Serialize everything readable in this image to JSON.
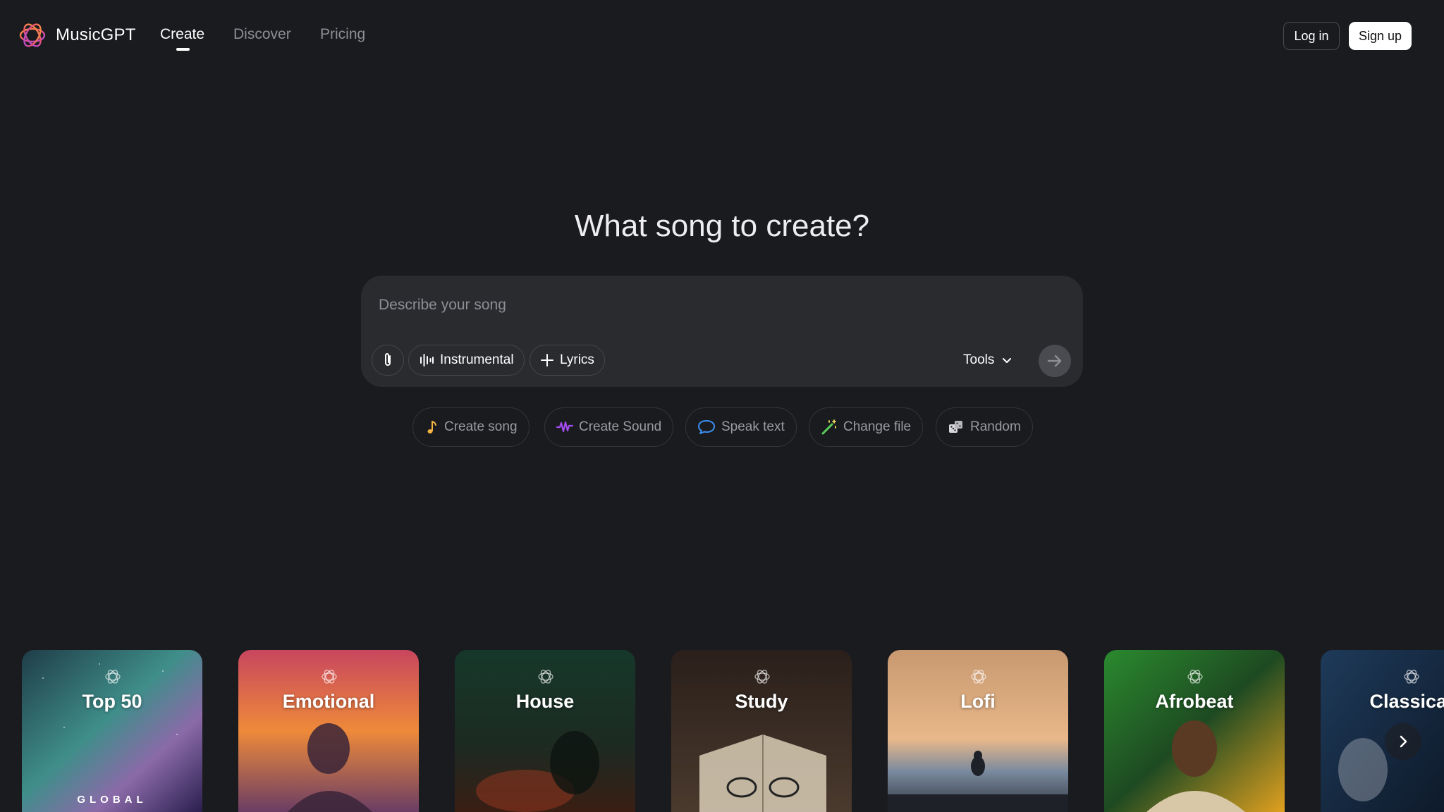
{
  "header": {
    "brand": "MusicGPT",
    "nav": [
      {
        "label": "Create",
        "active": true
      },
      {
        "label": "Discover",
        "active": false
      },
      {
        "label": "Pricing",
        "active": false
      }
    ],
    "login_label": "Log in",
    "signup_label": "Sign up"
  },
  "hero": {
    "title": "What song to create?"
  },
  "prompt": {
    "placeholder": "Describe your song",
    "value": "",
    "attach_icon": "paperclip-icon",
    "instrumental_label": "Instrumental",
    "lyrics_label": "Lyrics",
    "tools_label": "Tools",
    "send_icon": "arrow-right-icon"
  },
  "suggestions": [
    {
      "label": "Create song",
      "icon": "music-note-icon",
      "color": "#f5b342"
    },
    {
      "label": "Create Sound",
      "icon": "waveform-icon",
      "color": "#a24cf0"
    },
    {
      "label": "Speak text",
      "icon": "speech-bubble-icon",
      "color": "#3b8ff0"
    },
    {
      "label": "Change file",
      "icon": "magic-wand-icon",
      "color": "#5ad05a"
    },
    {
      "label": "Random",
      "icon": "dice-icon",
      "color": "#d0d0d0"
    }
  ],
  "playlists": [
    {
      "title": "Top 50",
      "subtitle": "GLOBAL"
    },
    {
      "title": "Emotional",
      "subtitle": ""
    },
    {
      "title": "House",
      "subtitle": ""
    },
    {
      "title": "Study",
      "subtitle": ""
    },
    {
      "title": "Lofi",
      "subtitle": ""
    },
    {
      "title": "Afrobeat",
      "subtitle": ""
    },
    {
      "title": "Classical",
      "subtitle": ""
    }
  ],
  "colors": {
    "background": "#1a1b1f",
    "prompt_box": "#2a2b2f",
    "accent_white": "#ffffff"
  }
}
